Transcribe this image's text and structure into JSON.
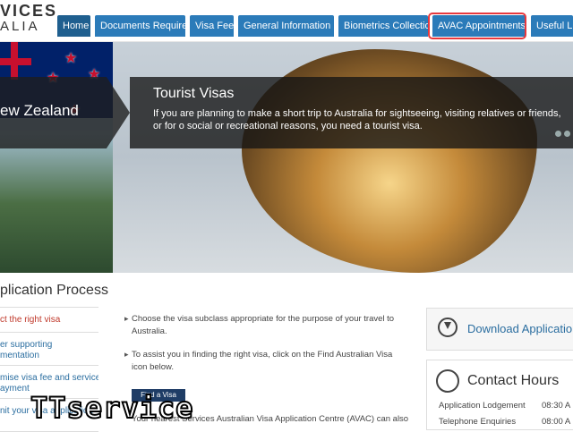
{
  "header": {
    "logo_line1": "VICES",
    "logo_line2": "ALIA"
  },
  "nav": [
    {
      "label": "Home"
    },
    {
      "label": "Documents Required"
    },
    {
      "label": "Visa Fee"
    },
    {
      "label": "General Information"
    },
    {
      "label": "Biometrics Collection"
    },
    {
      "label": "AVAC Appointments"
    },
    {
      "label": "Useful Li"
    }
  ],
  "banner": {
    "nz_title": "ew Zealand",
    "title": "Tourist Visas",
    "text": "If you are planning to make a short trip to Australia for sightseeing, visiting relatives or friends, or for o social or recreational reasons, you need a tourist visa."
  },
  "process": {
    "title": "plication Process",
    "side_items": [
      {
        "l1": "ct the right visa",
        "l2": ""
      },
      {
        "l1": "er supporting",
        "l2": "mentation"
      },
      {
        "l1": "mise visa fee and service",
        "l2": "ayment"
      },
      {
        "l1": "nit your visa application",
        "l2": ""
      }
    ],
    "bullets": [
      "Choose the visa subclass appropriate for the purpose of your travel to Australia.",
      "To assist you in finding the right visa, click on the Find Australian Visa icon below."
    ],
    "find_button": "Find a Visa",
    "bottom_text": "Your nearest Services Australian Visa Application Centre (AVAC) can also"
  },
  "download": {
    "label": "Download Application F"
  },
  "contact": {
    "title": "Contact Hours",
    "rows": [
      {
        "label": "Application Lodgement",
        "time": "08:30 A"
      },
      {
        "label": "Telephone Enquiries",
        "time": "08:00 A"
      }
    ]
  },
  "watermark": "TTservice"
}
